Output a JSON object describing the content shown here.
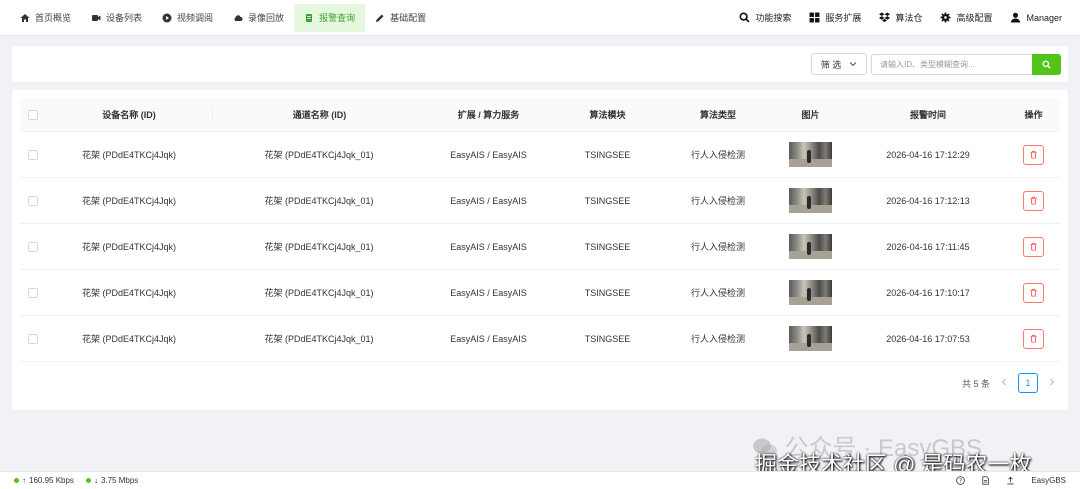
{
  "nav": {
    "left": [
      {
        "label": "首页概览",
        "icon": "home-icon"
      },
      {
        "label": "设备列表",
        "icon": "device-icon"
      },
      {
        "label": "视频调阅",
        "icon": "play-icon"
      },
      {
        "label": "录像回放",
        "icon": "cloud-icon"
      },
      {
        "label": "报警查询",
        "icon": "alarm-icon",
        "active": true
      },
      {
        "label": "基础配置",
        "icon": "edit-icon"
      }
    ],
    "right": [
      {
        "label": "功能搜索",
        "icon": "search-icon"
      },
      {
        "label": "服务扩展",
        "icon": "grid-icon"
      },
      {
        "label": "算法仓",
        "icon": "dropbox-icon"
      },
      {
        "label": "高级配置",
        "icon": "gear-icon"
      },
      {
        "label": "Manager",
        "icon": "user-icon"
      }
    ]
  },
  "filter": {
    "select_label": "筛 选",
    "search_placeholder": "请输入ID、类型模糊查询..."
  },
  "table": {
    "headers": {
      "device": "设备名称 (ID)",
      "channel": "通道名称 (ID)",
      "service": "扩展 / 算力服务",
      "algorithm": "算法模块",
      "type": "算法类型",
      "image": "图片",
      "time": "报警时间",
      "action": "操作"
    },
    "rows": [
      {
        "device": "花架 (PDdE4TKCj4Jqk)",
        "channel": "花架 (PDdE4TKCj4Jqk_01)",
        "service": "EasyAIS / EasyAIS",
        "algorithm": "TSINGSEE",
        "type": "行人入侵检测",
        "time": "2026-04-16 17:12:29"
      },
      {
        "device": "花架 (PDdE4TKCj4Jqk)",
        "channel": "花架 (PDdE4TKCj4Jqk_01)",
        "service": "EasyAIS / EasyAIS",
        "algorithm": "TSINGSEE",
        "type": "行人入侵检测",
        "time": "2026-04-16 17:12:13"
      },
      {
        "device": "花架 (PDdE4TKCj4Jqk)",
        "channel": "花架 (PDdE4TKCj4Jqk_01)",
        "service": "EasyAIS / EasyAIS",
        "algorithm": "TSINGSEE",
        "type": "行人入侵检测",
        "time": "2026-04-16 17:11:45"
      },
      {
        "device": "花架 (PDdE4TKCj4Jqk)",
        "channel": "花架 (PDdE4TKCj4Jqk_01)",
        "service": "EasyAIS / EasyAIS",
        "algorithm": "TSINGSEE",
        "type": "行人入侵检测",
        "time": "2026-04-16 17:10:17"
      },
      {
        "device": "花架 (PDdE4TKCj4Jqk)",
        "channel": "花架 (PDdE4TKCj4Jqk_01)",
        "service": "EasyAIS / EasyAIS",
        "algorithm": "TSINGSEE",
        "type": "行人入侵检测",
        "time": "2026-04-16 17:07:53"
      }
    ]
  },
  "pagination": {
    "total": "共 5 条",
    "current_page": "1"
  },
  "footer": {
    "upload": "160.95 Kbps",
    "download": "3.75 Mbps",
    "brand": "EasyGBS"
  },
  "watermark": {
    "line1": "公众号 · EasyGBS",
    "line2": "掘金技术社区 @ 是码农一枚"
  },
  "colors": {
    "accent": "#52c41a",
    "active_nav_bg": "#e6f7e0",
    "danger": "#ff4d4f",
    "page_link": "#1890ff"
  }
}
